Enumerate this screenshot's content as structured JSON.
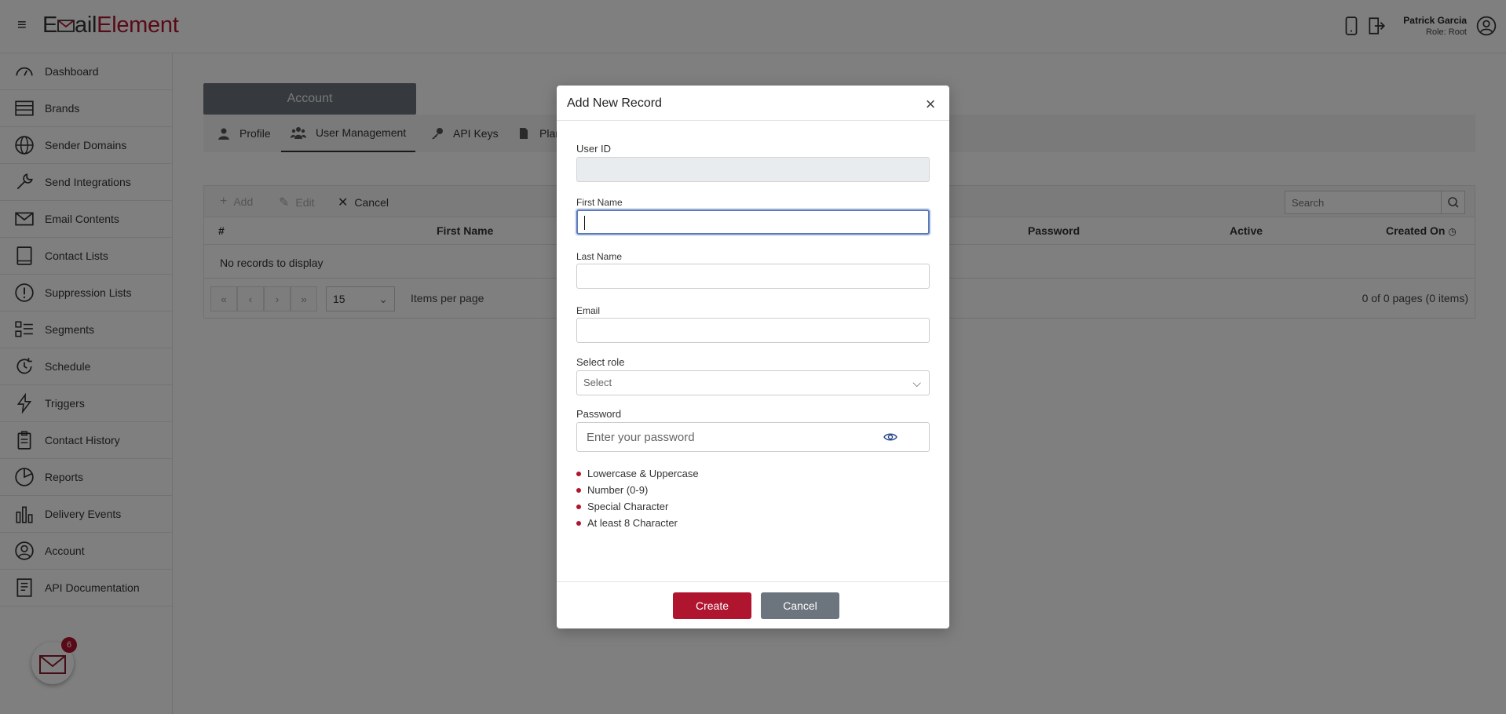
{
  "app": {
    "logo_prefix": "E",
    "logo_middle": "ail",
    "logo_suffix": "Element",
    "accent_color": "#b0152f"
  },
  "header": {
    "user_name": "Patrick Garcia",
    "user_role": "Role: Root",
    "icons": [
      "hamburger-icon",
      "mobile-icon",
      "exit-icon",
      "user-avatar-icon"
    ]
  },
  "sidebar": {
    "items": [
      {
        "label": "Dashboard",
        "icon": "dashboard-icon"
      },
      {
        "label": "Brands",
        "icon": "brands-icon"
      },
      {
        "label": "Sender Domains",
        "icon": "globe-icon"
      },
      {
        "label": "Send Integrations",
        "icon": "wrench-icon"
      },
      {
        "label": "Email Contents",
        "icon": "envelope-icon"
      },
      {
        "label": "Contact Lists",
        "icon": "contact-book-icon"
      },
      {
        "label": "Suppression Lists",
        "icon": "alert-circle-icon"
      },
      {
        "label": "Segments",
        "icon": "segments-icon"
      },
      {
        "label": "Schedule",
        "icon": "schedule-icon"
      },
      {
        "label": "Triggers",
        "icon": "lightning-icon"
      },
      {
        "label": "Contact History",
        "icon": "clipboard-icon"
      },
      {
        "label": "Reports",
        "icon": "pie-chart-icon"
      },
      {
        "label": "Delivery Events",
        "icon": "bar-chart-icon"
      },
      {
        "label": "Account",
        "icon": "account-icon"
      },
      {
        "label": "API Documentation",
        "icon": "document-icon"
      }
    ],
    "notification_count": "6"
  },
  "page": {
    "account_tab": "Account",
    "tabs": [
      {
        "label": "Profile",
        "icon": "person-icon"
      },
      {
        "label": "User Management",
        "icon": "users-icon"
      },
      {
        "label": "API Keys",
        "icon": "key-icon"
      },
      {
        "label": "Plan",
        "icon": "file-icon"
      }
    ],
    "toolbar": {
      "add_label": "Add",
      "edit_label": "Edit",
      "cancel_label": "Cancel",
      "search_placeholder": "Search"
    },
    "columns": [
      "#",
      "First Name",
      "Password",
      "Active",
      "Created On"
    ],
    "empty_text": "No records to display",
    "pager": {
      "first": "«",
      "prev": "‹",
      "next": "›",
      "last": "»",
      "page_size": "15",
      "items_per_page": "Items per page",
      "page_info": "0 of 0 pages (0 items)"
    }
  },
  "modal": {
    "title": "Add New Record",
    "fields": {
      "user_id_label": "User ID",
      "first_name_label": "First Name",
      "last_name_label": "Last Name",
      "email_label": "Email",
      "role_label": "Select role",
      "role_value": "Select",
      "password_label": "Password",
      "password_placeholder": "Enter your password"
    },
    "requirements": [
      "Lowercase & Uppercase",
      "Number (0-9)",
      "Special Character",
      "At least 8 Character"
    ],
    "create_label": "Create",
    "cancel_label": "Cancel"
  }
}
